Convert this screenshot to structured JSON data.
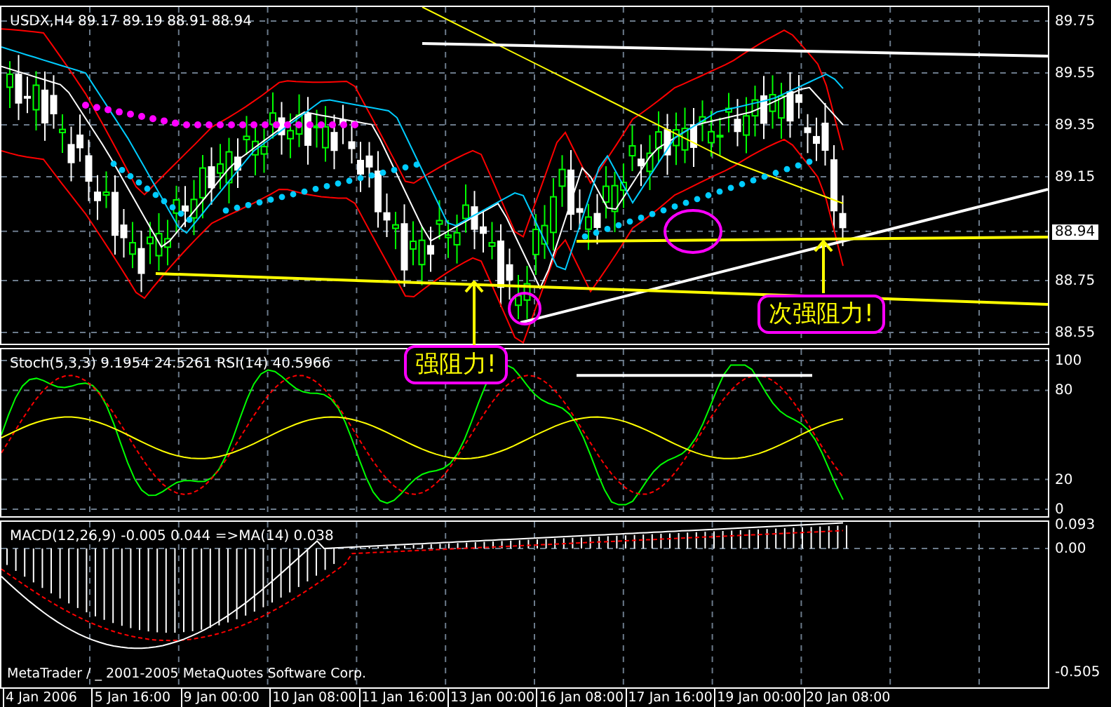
{
  "symbol_header": "USDX,H4  89.17 89.19 88.91 88.94",
  "price_axis": {
    "labels": [
      "89.75",
      "89.55",
      "89.35",
      "89.15",
      "88.75",
      "88.55"
    ],
    "current_price": "88.94"
  },
  "annotations": [
    {
      "text": "强阻力!"
    },
    {
      "text": "次强阻力!"
    }
  ],
  "stoch_pane": {
    "header": "Stoch(5,3,3) 9.1954 24.5261  RSI(14) 40.5966",
    "axis_labels": [
      "100",
      "80",
      "20",
      "0"
    ]
  },
  "macd_pane": {
    "header": "MACD(12,26,9) -0.005 0.044  =>MA(14) 0.038",
    "axis_labels": [
      "0.093",
      "0.00",
      "-0.505"
    ],
    "copyright": "MetaTrader / _ 2001-2005 MetaQuotes Software Corp."
  },
  "time_axis": [
    "4 Jan 2006",
    "5 Jan 16:00",
    "9 Jan 00:00",
    "10 Jan 08:00",
    "11 Jan 16:00",
    "13 Jan 00:00",
    "16 Jan 08:00",
    "17 Jan 16:00",
    "19 Jan 00:00",
    "20 Jan 08:00"
  ]
}
